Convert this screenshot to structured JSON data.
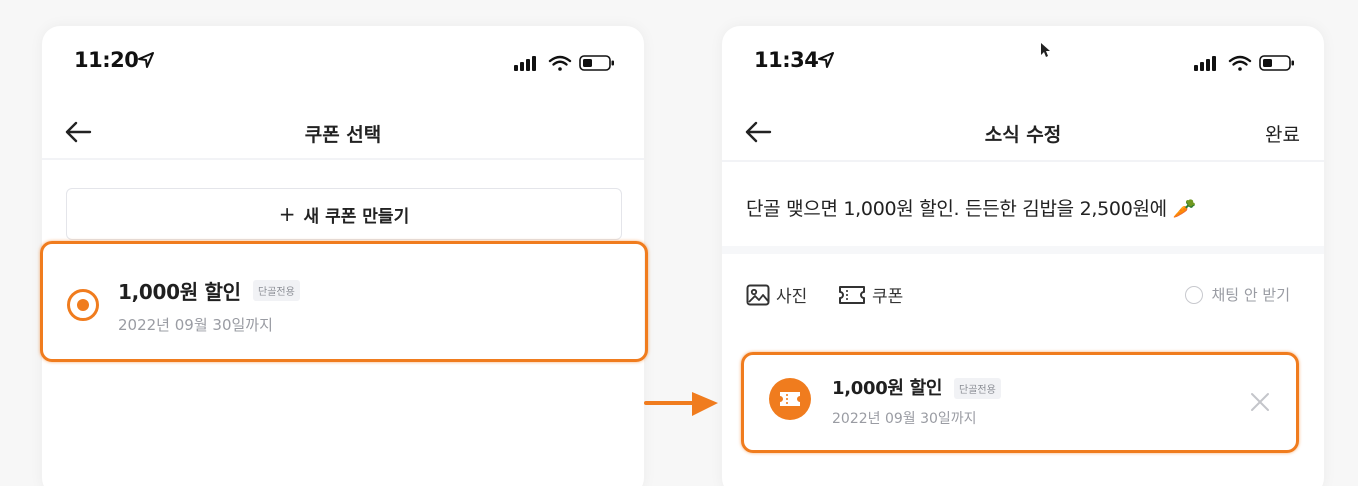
{
  "left_screen": {
    "status_time": "11:20",
    "nav_title": "쿠폰 선택",
    "new_coupon_button": "새 쿠폰 만들기",
    "coupon": {
      "title": "1,000원 할인",
      "tag": "단골전용",
      "expiry": "2022년 09월 30일까지",
      "selected": true
    }
  },
  "right_screen": {
    "status_time": "11:34",
    "nav_title": "소식 수정",
    "nav_done": "완료",
    "post_text": "단골 맺으면 1,000원 할인. 든든한 김밥을 2,500원에 🥕",
    "attach_photo": "사진",
    "attach_coupon": "쿠폰",
    "chat_option": "채팅 안 받기",
    "coupon": {
      "title": "1,000원 할인",
      "tag": "단골전용",
      "expiry": "2022년 09월 30일까지"
    }
  },
  "colors": {
    "accent": "#f07c1e",
    "text": "#212124",
    "muted": "#9a9ca3",
    "background": "#f7f7f7"
  },
  "icons": [
    "location-arrow-icon",
    "signal-icon",
    "wifi-icon",
    "battery-icon",
    "back-arrow-icon",
    "plus-icon",
    "photo-icon",
    "coupon-icon",
    "close-icon",
    "flow-arrow-icon",
    "mouse-cursor-icon"
  ]
}
